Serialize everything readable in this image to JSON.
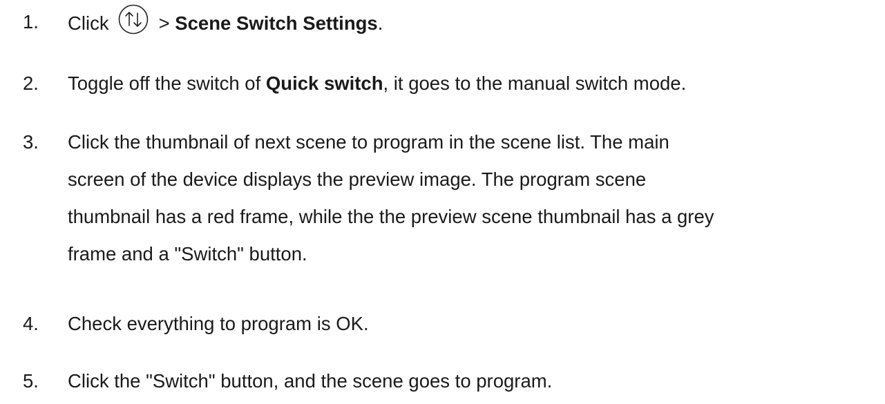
{
  "steps": [
    {
      "number": "1.",
      "before": "Click",
      "icon": "up-down-arrows-circle-icon",
      "sep": ">",
      "bold": "Scene Switch Settings",
      "after": "."
    },
    {
      "number": "2.",
      "before": "Toggle off the switch of ",
      "bold": "Quick switch",
      "after": ", it goes to the manual switch mode."
    },
    {
      "number": "3.",
      "lines": [
        "Click the thumbnail of next scene to program in the scene list. The main",
        "screen of the device displays the preview image. The program scene",
        "thumbnail has a red frame, while the the preview scene thumbnail has a grey",
        "frame and a \"Switch\" button."
      ]
    },
    {
      "number": "4.",
      "text": "Check everything to program is OK."
    },
    {
      "number": "5.",
      "text": "Click the \"Switch\" button, and the scene goes to program."
    }
  ]
}
